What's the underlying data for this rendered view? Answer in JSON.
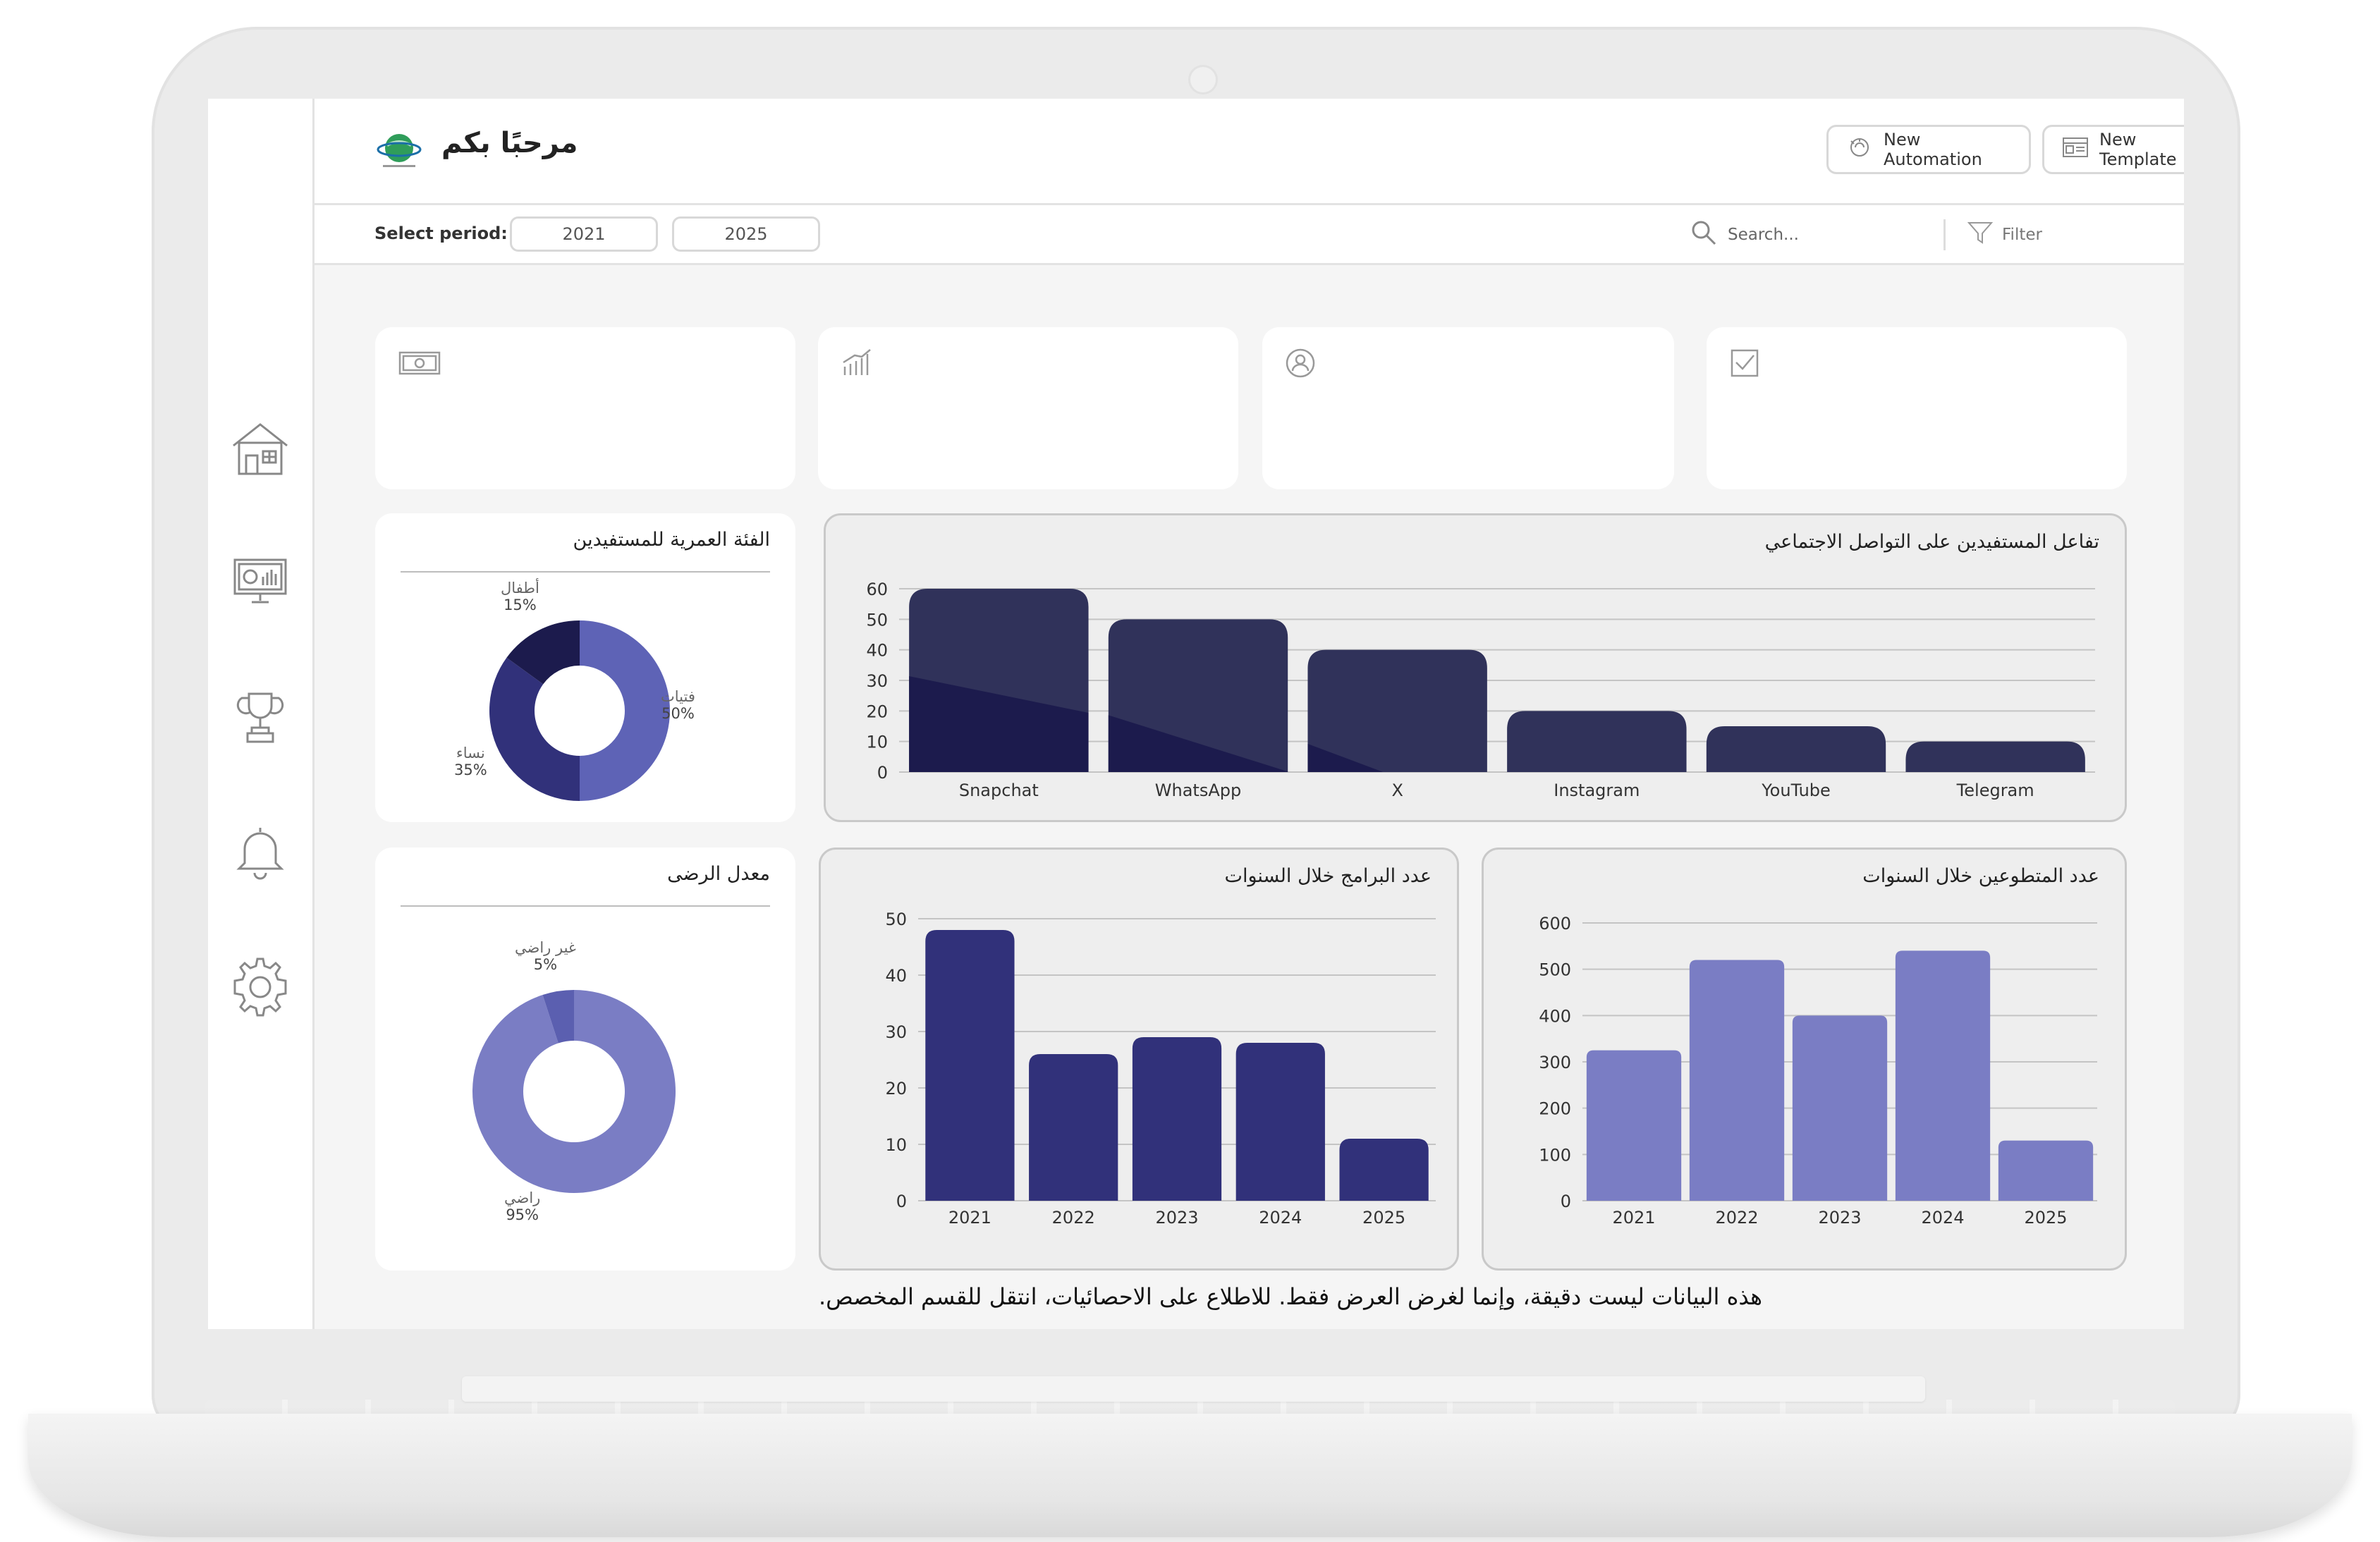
{
  "header": {
    "welcome": "مرحبًا بكم",
    "new_automation": "New Automation",
    "new_template": "New Template"
  },
  "period": {
    "label": "Select period:",
    "from": "2021",
    "to": "2025"
  },
  "search": {
    "placeholder": "Search..."
  },
  "filter": {
    "label": "Filter"
  },
  "sidebar": {
    "items": [
      "home-icon",
      "monitor-chart-icon",
      "trophy-icon",
      "bell-icon",
      "gear-icon"
    ]
  },
  "kpis": [
    "money-icon",
    "growth-chart-icon",
    "user-icon",
    "check-icon"
  ],
  "age_chart": {
    "title": "الفئة العمرية للمستفيدين",
    "slices": [
      {
        "label": "فتيات",
        "value": "50%"
      },
      {
        "label": "نساء",
        "value": "35%"
      },
      {
        "label": "أطفال",
        "value": "15%"
      }
    ]
  },
  "satisfaction_chart": {
    "title": "معدل الرضى",
    "slices": [
      {
        "label": "راضي",
        "value": "95%"
      },
      {
        "label": "غير راضي",
        "value": "5%"
      }
    ]
  },
  "programs_chart": {
    "title": "عدد البرامج خلال السنوات"
  },
  "volunteers_chart": {
    "title": "عدد المتطوعين خلال السنوات"
  },
  "social_chart": {
    "title": "تفاعل المستفيدين على التواصل الاجتماعي"
  },
  "footer": {
    "note": "هذه البيانات ليست دقيقة، وإنما لغرض العرض فقط. للاطلاع على الاحصائيات، انتقل للقسم المخصص."
  },
  "colors": {
    "dark_navy": "#30325a",
    "navy": "#31317a",
    "indigo": "#5e63b6",
    "lavender": "#7a7dc4",
    "deep": "#1c1b4d"
  },
  "chart_data": [
    {
      "type": "bar",
      "title": "تفاعل المستفيدين على التواصل الاجتماعي",
      "categories": [
        "Snapchat",
        "WhatsApp",
        "X",
        "Instagram",
        "YouTube",
        "Telegram"
      ],
      "values": [
        60,
        50,
        40,
        20,
        15,
        10
      ],
      "ylim": [
        0,
        60
      ],
      "yticks": [
        0,
        10,
        20,
        30,
        40,
        50,
        60
      ],
      "grid": true
    },
    {
      "type": "bar",
      "title": "عدد البرامج خلال السنوات",
      "categories": [
        "2021",
        "2022",
        "2023",
        "2024",
        "2025"
      ],
      "values": [
        48,
        26,
        29,
        28,
        11
      ],
      "ylim": [
        0,
        50
      ],
      "yticks": [
        0,
        10,
        20,
        30,
        40,
        50
      ],
      "grid": true
    },
    {
      "type": "bar",
      "title": "عدد المتطوعين خلال السنوات",
      "categories": [
        "2021",
        "2022",
        "2023",
        "2024",
        "2025"
      ],
      "values": [
        325,
        520,
        400,
        540,
        130
      ],
      "ylim": [
        0,
        600
      ],
      "yticks": [
        0,
        100,
        200,
        300,
        400,
        500,
        600
      ],
      "grid": true
    },
    {
      "type": "pie",
      "title": "الفئة العمرية للمستفيدين",
      "categories": [
        "فتيات",
        "نساء",
        "أطفال"
      ],
      "values": [
        50,
        35,
        15
      ]
    },
    {
      "type": "pie",
      "title": "معدل الرضى",
      "categories": [
        "راضي",
        "غير راضي"
      ],
      "values": [
        95,
        5
      ]
    }
  ]
}
